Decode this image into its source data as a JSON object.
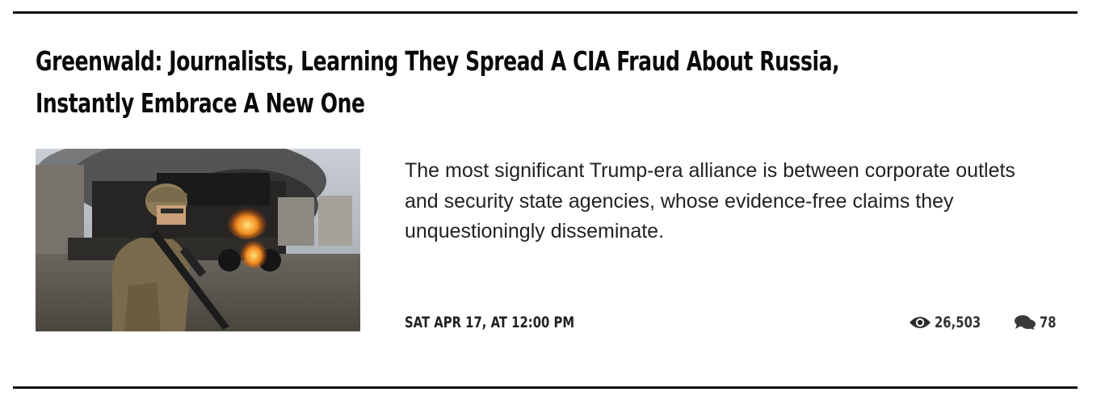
{
  "article": {
    "title": "Greenwald: Journalists, Learning They Spread A CIA Fraud About Russia, Instantly Embrace A New One",
    "title_line1": "Greenwald: Journalists, Learning They Spread A CIA Fraud About Russia,",
    "title_line2": "Instantly Embrace A New One",
    "excerpt": "The most significant Trump-era alliance is between corporate outlets and security state agencies, whose evidence-free claims they unquestioningly disseminate.",
    "date": "SAT APR 17, AT 12:00 PM",
    "views": "26,503",
    "comments": "78",
    "thumbnail_icon": "soldier-photo"
  },
  "icons": {
    "views": "eye-icon",
    "comments": "comments-icon"
  },
  "colors": {
    "text": "#111111",
    "rule": "#111111",
    "meta": "#333333"
  }
}
